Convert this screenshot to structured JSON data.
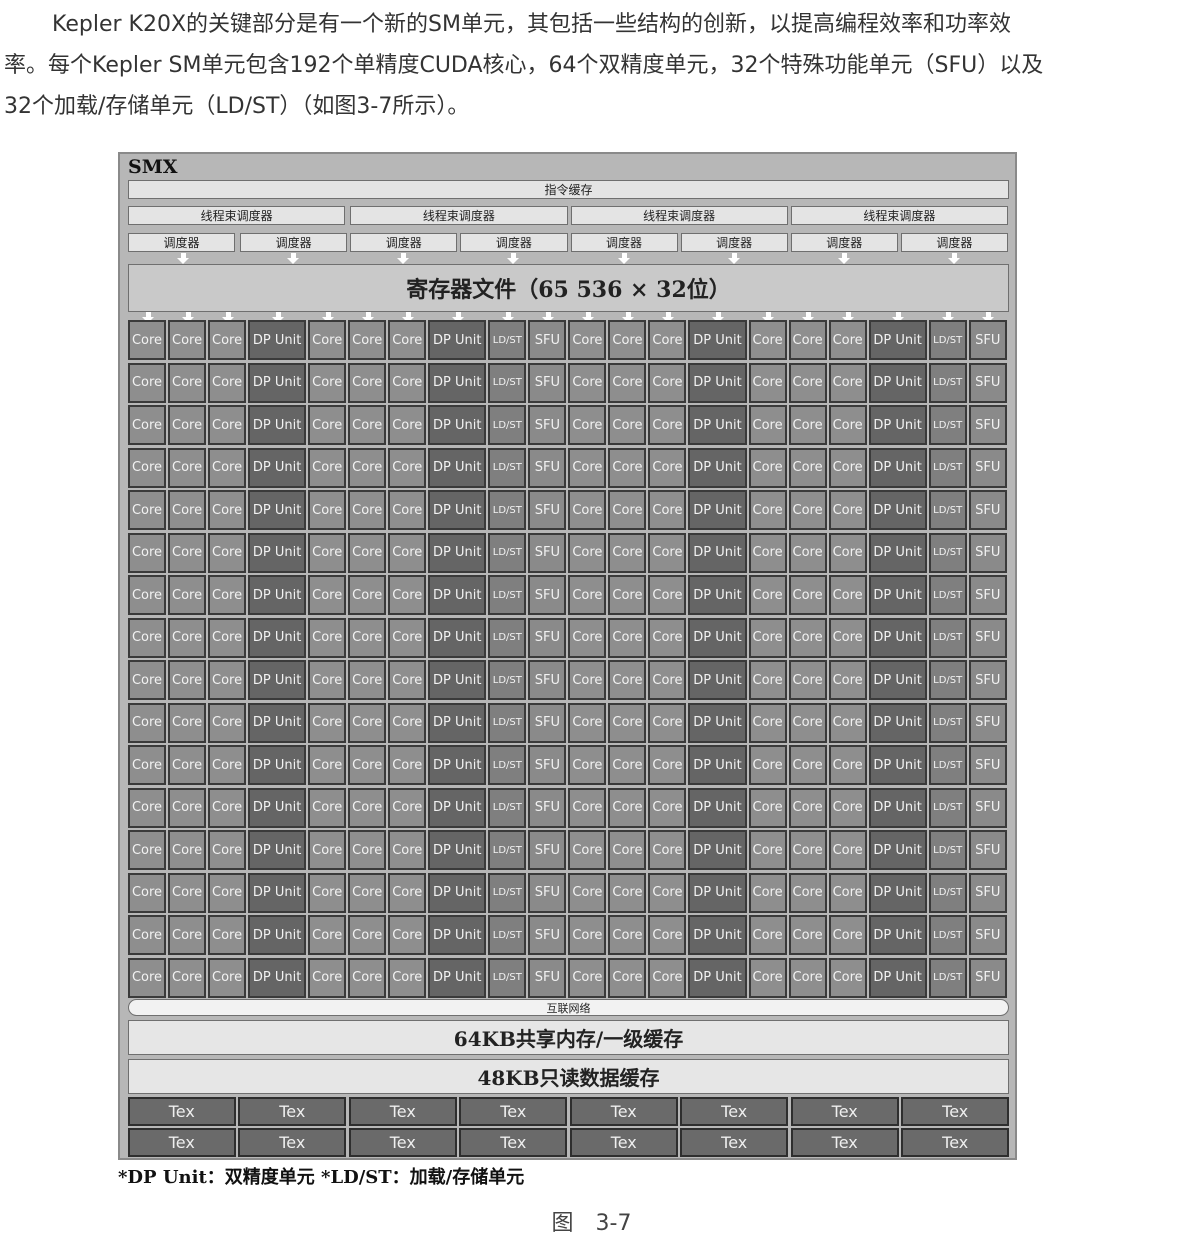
{
  "paragraph": {
    "line1": "Kepler K20X的关键部分是有一个新的SM单元，其包括一些结构的创新，以提高编程效率和功率效",
    "line2": "率。每个Kepler SM单元包含192个单精度CUDA核心，64个双精度单元，32个特殊功能单元（SFU）以及",
    "line3": "32个加载/存储单元（LD/ST）（如图3-7所示）。"
  },
  "figure": {
    "title": "SMX",
    "instruction_cache": "指令缓存",
    "warp_schedulers": [
      "线程束调度器",
      "线程束调度器",
      "线程束调度器",
      "线程束调度器"
    ],
    "dispatch_units": [
      "调度器",
      "调度器",
      "调度器",
      "调度器",
      "调度器",
      "调度器",
      "调度器",
      "调度器"
    ],
    "register_file": "寄存器文件（65 536 × 32位）",
    "unit_row_pattern": [
      "Core",
      "Core",
      "Core",
      "DP Unit",
      "Core",
      "Core",
      "Core",
      "DP Unit",
      "LD/ST",
      "SFU",
      "Core",
      "Core",
      "Core",
      "DP Unit",
      "Core",
      "Core",
      "Core",
      "DP Unit",
      "LD/ST",
      "SFU"
    ],
    "unit_row_count": 16,
    "interconnect": "互联网络",
    "shared_memory": "64KB共享内存/一级缓存",
    "readonly_cache": "48KB只读数据缓存",
    "tex_rows": [
      [
        "Tex",
        "Tex",
        "Tex",
        "Tex",
        "Tex",
        "Tex",
        "Tex",
        "Tex"
      ],
      [
        "Tex",
        "Tex",
        "Tex",
        "Tex",
        "Tex",
        "Tex",
        "Tex",
        "Tex"
      ]
    ],
    "legend": "*DP Unit：双精度单元 *LD/ST：加载/存储单元"
  },
  "caption": "图　3-7"
}
